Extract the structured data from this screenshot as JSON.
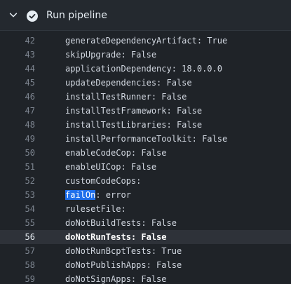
{
  "header": {
    "title": "Run pipeline",
    "chevron_icon": "chevron-down-icon",
    "status_icon": "check-circle-icon",
    "status_color": "#e6edf3"
  },
  "log": {
    "lines": [
      {
        "num": "42",
        "text": "generateDependencyArtifact: True"
      },
      {
        "num": "43",
        "text": "skipUpgrade: False"
      },
      {
        "num": "44",
        "text": "applicationDependency: 18.0.0.0"
      },
      {
        "num": "45",
        "text": "updateDependencies: False"
      },
      {
        "num": "46",
        "text": "installTestRunner: False"
      },
      {
        "num": "47",
        "text": "installTestFramework: False"
      },
      {
        "num": "48",
        "text": "installTestLibraries: False"
      },
      {
        "num": "49",
        "text": "installPerformanceToolkit: False"
      },
      {
        "num": "50",
        "text": "enableCodeCop: False"
      },
      {
        "num": "51",
        "text": "enableUICop: False"
      },
      {
        "num": "52",
        "text": "customCodeCops:"
      },
      {
        "num": "53",
        "text": "failOn: error",
        "selected": "failOn"
      },
      {
        "num": "54",
        "text": "rulesetFile:"
      },
      {
        "num": "55",
        "text": "doNotBuildTests: False"
      },
      {
        "num": "56",
        "text": "doNotRunTests: False",
        "active": true
      },
      {
        "num": "57",
        "text": "doNotRunBcptTests: True"
      },
      {
        "num": "58",
        "text": "doNotPublishApps: False"
      },
      {
        "num": "59",
        "text": "doNotSignApps: False"
      }
    ]
  }
}
